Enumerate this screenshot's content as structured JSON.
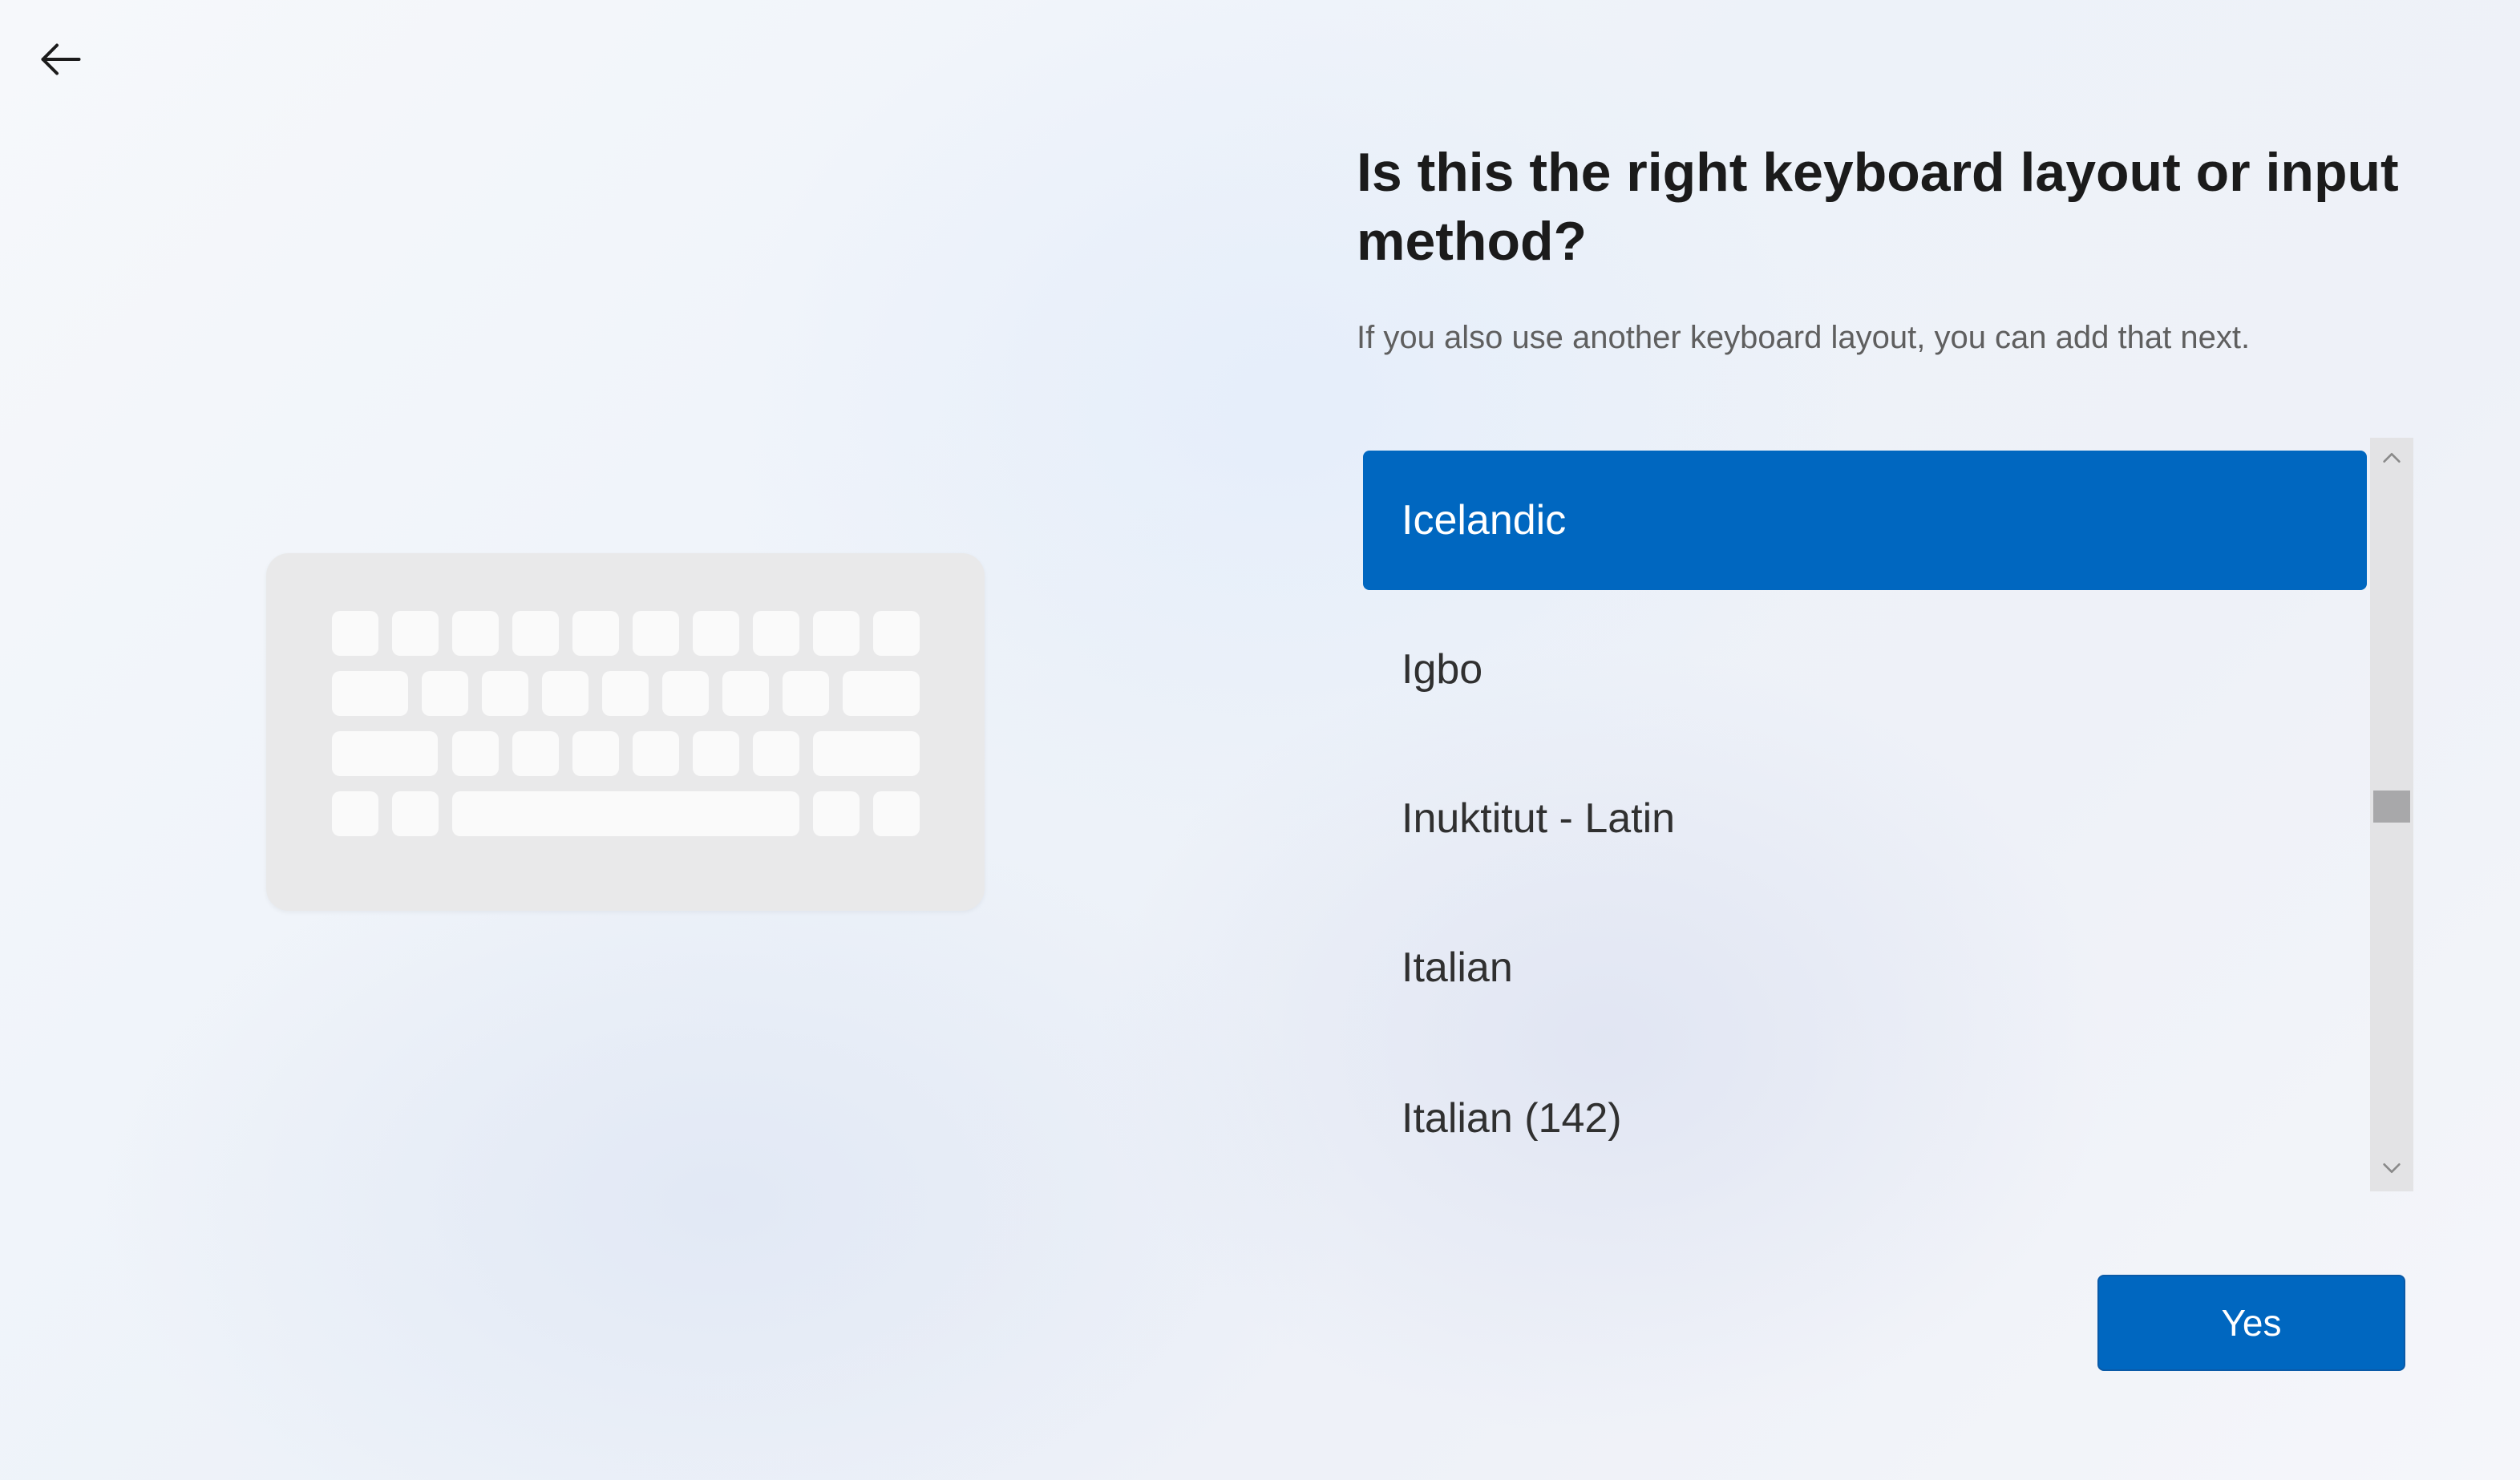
{
  "header": {
    "back_icon": "arrow-left-icon"
  },
  "illustration": {
    "icon": "keyboard-illustration"
  },
  "main": {
    "title": "Is this the right keyboard layout or input method?",
    "subtitle": "If you also use another keyboard layout, you can add that next."
  },
  "layouts": {
    "items": [
      {
        "label": "Icelandic",
        "selected": true
      },
      {
        "label": "Igbo",
        "selected": false
      },
      {
        "label": "Inuktitut - Latin",
        "selected": false
      },
      {
        "label": "Italian",
        "selected": false
      },
      {
        "label": "Italian (142)",
        "selected": false
      }
    ]
  },
  "scrollbar": {
    "up_icon": "chevron-up-icon",
    "down_icon": "chevron-down-icon"
  },
  "footer": {
    "yes_label": "Yes"
  },
  "colors": {
    "accent": "#0067c0",
    "selected_text": "#ffffff",
    "text": "#1b1b1b",
    "secondary_text": "#5f5f5f"
  }
}
